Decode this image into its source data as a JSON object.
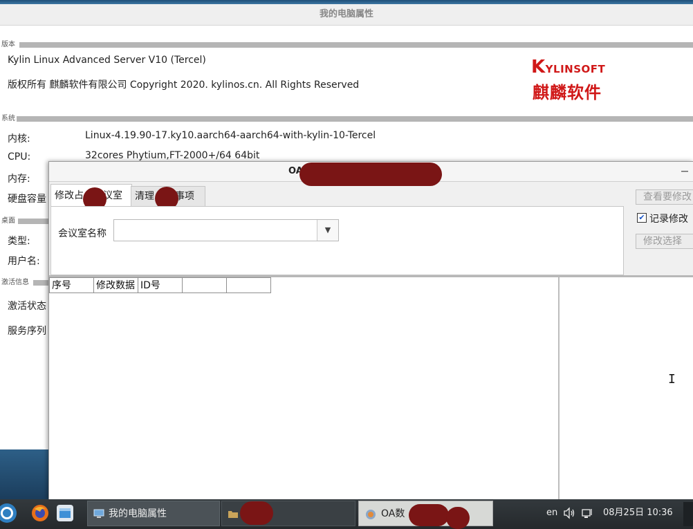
{
  "props_window": {
    "title": "我的电脑属性",
    "sections": {
      "version": "版本",
      "system": "系统",
      "desktop": "桌面",
      "activation": "激活信息"
    },
    "os_name": "Kylin Linux Advanced Server V10 (Tercel)",
    "copyright": "版权所有 麒麟软件有限公司 Copyright 2020. kylinos.cn. All Rights Reserved",
    "logo_en": "KYLINSOFT",
    "logo_cn": "麒麟软件",
    "rows": {
      "kernel_label": "内核:",
      "kernel_value": "Linux-4.19.90-17.ky10.aarch64-aarch64-with-kylin-10-Tercel",
      "cpu_label": "CPU:",
      "cpu_value": "32cores Phytium,FT-2000+/64 64bit",
      "memory_label": "内存:",
      "disk_label": "硬盘容量",
      "type_label": "类型:",
      "user_label": "用户名:",
      "activation_label": "激活状态",
      "serial_label": "服务序列"
    }
  },
  "oa_window": {
    "title_prefix": "OA",
    "tabs": [
      {
        "label_a": "修改占",
        "label_b": "议室"
      },
      {
        "label_a": "清理",
        "label_b": "事项"
      }
    ],
    "room_label": "会议室名称",
    "room_value": "",
    "buttons": {
      "view": "查看要修改",
      "modify": "修改选择"
    },
    "checkbox": {
      "label": "记录修改",
      "checked": true,
      "mark": "✔"
    },
    "table_headers": [
      "序号",
      "修改数据",
      "ID号",
      "",
      ""
    ]
  },
  "taskbar": {
    "tasks": [
      {
        "label": "我的电脑属性"
      },
      {
        "label": ""
      },
      {
        "label_a": "OA数",
        "label_b": "… "
      }
    ],
    "lang": "en",
    "datetime": "08月25日 10:36"
  },
  "colors": {
    "logo_red": "#d01818",
    "taskbar": "#2b3033",
    "redaction": "#7a1515"
  }
}
